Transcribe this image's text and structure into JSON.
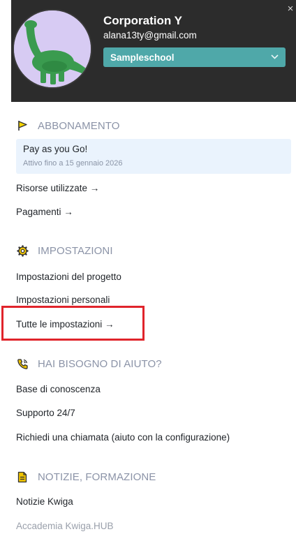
{
  "header": {
    "org_name": "Corporation Y",
    "email": "alana13ty@gmail.com",
    "school": "Sampleschool",
    "close_label": "×",
    "select_chevron": "⌄"
  },
  "subscription": {
    "title": "ABBONAMENTO",
    "plan_name": "Pay as you Go!",
    "plan_until": "Attivo fino a 15 gennaio 2026",
    "links": [
      "Risorse utilizzate →",
      "Pagamenti →"
    ]
  },
  "settings": {
    "title": "IMPOSTAZIONI",
    "links": [
      "Impostazioni del progetto",
      "Impostazioni personali",
      "Tutte le impostazioni →"
    ]
  },
  "help": {
    "title": "HAI BISOGNO DI AIUTO?",
    "links": [
      "Base di conoscenza",
      "Supporto 24/7",
      "Richiedi una chiamata (aiuto con la configurazione)"
    ]
  },
  "news": {
    "title": "NOTIZIE, FORMAZIONE",
    "links": [
      "Notizie Kwiga",
      "Accademia Kwiga.HUB"
    ]
  },
  "colors": {
    "header_bg": "#2c2c2c",
    "select_bg": "#4fa8a9",
    "icon_yellow": "#e8c100",
    "highlight_red": "#e0242b",
    "plan_box_bg": "#eaf3fd"
  }
}
